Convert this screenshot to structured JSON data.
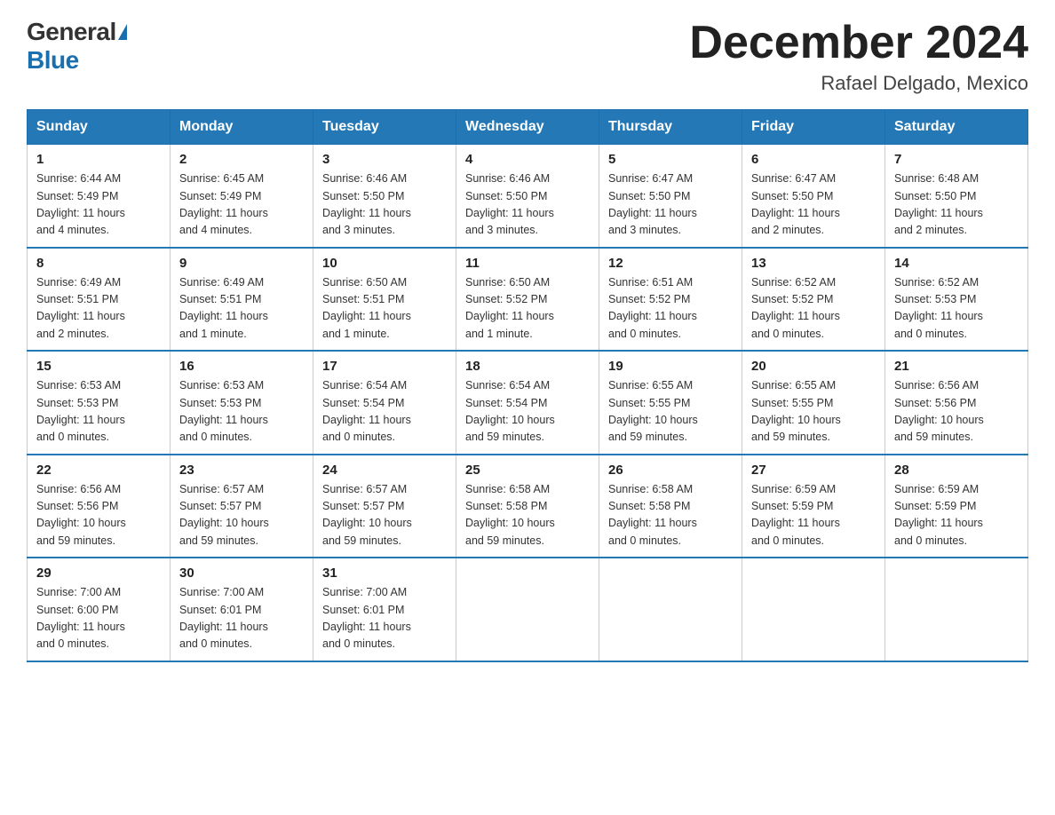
{
  "header": {
    "logo_general": "General",
    "logo_blue": "Blue",
    "month_title": "December 2024",
    "location": "Rafael Delgado, Mexico"
  },
  "days_of_week": [
    "Sunday",
    "Monday",
    "Tuesday",
    "Wednesday",
    "Thursday",
    "Friday",
    "Saturday"
  ],
  "weeks": [
    [
      {
        "day": "1",
        "sunrise": "6:44 AM",
        "sunset": "5:49 PM",
        "daylight": "11 hours and 4 minutes."
      },
      {
        "day": "2",
        "sunrise": "6:45 AM",
        "sunset": "5:49 PM",
        "daylight": "11 hours and 4 minutes."
      },
      {
        "day": "3",
        "sunrise": "6:46 AM",
        "sunset": "5:50 PM",
        "daylight": "11 hours and 3 minutes."
      },
      {
        "day": "4",
        "sunrise": "6:46 AM",
        "sunset": "5:50 PM",
        "daylight": "11 hours and 3 minutes."
      },
      {
        "day": "5",
        "sunrise": "6:47 AM",
        "sunset": "5:50 PM",
        "daylight": "11 hours and 3 minutes."
      },
      {
        "day": "6",
        "sunrise": "6:47 AM",
        "sunset": "5:50 PM",
        "daylight": "11 hours and 2 minutes."
      },
      {
        "day": "7",
        "sunrise": "6:48 AM",
        "sunset": "5:50 PM",
        "daylight": "11 hours and 2 minutes."
      }
    ],
    [
      {
        "day": "8",
        "sunrise": "6:49 AM",
        "sunset": "5:51 PM",
        "daylight": "11 hours and 2 minutes."
      },
      {
        "day": "9",
        "sunrise": "6:49 AM",
        "sunset": "5:51 PM",
        "daylight": "11 hours and 1 minute."
      },
      {
        "day": "10",
        "sunrise": "6:50 AM",
        "sunset": "5:51 PM",
        "daylight": "11 hours and 1 minute."
      },
      {
        "day": "11",
        "sunrise": "6:50 AM",
        "sunset": "5:52 PM",
        "daylight": "11 hours and 1 minute."
      },
      {
        "day": "12",
        "sunrise": "6:51 AM",
        "sunset": "5:52 PM",
        "daylight": "11 hours and 0 minutes."
      },
      {
        "day": "13",
        "sunrise": "6:52 AM",
        "sunset": "5:52 PM",
        "daylight": "11 hours and 0 minutes."
      },
      {
        "day": "14",
        "sunrise": "6:52 AM",
        "sunset": "5:53 PM",
        "daylight": "11 hours and 0 minutes."
      }
    ],
    [
      {
        "day": "15",
        "sunrise": "6:53 AM",
        "sunset": "5:53 PM",
        "daylight": "11 hours and 0 minutes."
      },
      {
        "day": "16",
        "sunrise": "6:53 AM",
        "sunset": "5:53 PM",
        "daylight": "11 hours and 0 minutes."
      },
      {
        "day": "17",
        "sunrise": "6:54 AM",
        "sunset": "5:54 PM",
        "daylight": "11 hours and 0 minutes."
      },
      {
        "day": "18",
        "sunrise": "6:54 AM",
        "sunset": "5:54 PM",
        "daylight": "10 hours and 59 minutes."
      },
      {
        "day": "19",
        "sunrise": "6:55 AM",
        "sunset": "5:55 PM",
        "daylight": "10 hours and 59 minutes."
      },
      {
        "day": "20",
        "sunrise": "6:55 AM",
        "sunset": "5:55 PM",
        "daylight": "10 hours and 59 minutes."
      },
      {
        "day": "21",
        "sunrise": "6:56 AM",
        "sunset": "5:56 PM",
        "daylight": "10 hours and 59 minutes."
      }
    ],
    [
      {
        "day": "22",
        "sunrise": "6:56 AM",
        "sunset": "5:56 PM",
        "daylight": "10 hours and 59 minutes."
      },
      {
        "day": "23",
        "sunrise": "6:57 AM",
        "sunset": "5:57 PM",
        "daylight": "10 hours and 59 minutes."
      },
      {
        "day": "24",
        "sunrise": "6:57 AM",
        "sunset": "5:57 PM",
        "daylight": "10 hours and 59 minutes."
      },
      {
        "day": "25",
        "sunrise": "6:58 AM",
        "sunset": "5:58 PM",
        "daylight": "10 hours and 59 minutes."
      },
      {
        "day": "26",
        "sunrise": "6:58 AM",
        "sunset": "5:58 PM",
        "daylight": "11 hours and 0 minutes."
      },
      {
        "day": "27",
        "sunrise": "6:59 AM",
        "sunset": "5:59 PM",
        "daylight": "11 hours and 0 minutes."
      },
      {
        "day": "28",
        "sunrise": "6:59 AM",
        "sunset": "5:59 PM",
        "daylight": "11 hours and 0 minutes."
      }
    ],
    [
      {
        "day": "29",
        "sunrise": "7:00 AM",
        "sunset": "6:00 PM",
        "daylight": "11 hours and 0 minutes."
      },
      {
        "day": "30",
        "sunrise": "7:00 AM",
        "sunset": "6:01 PM",
        "daylight": "11 hours and 0 minutes."
      },
      {
        "day": "31",
        "sunrise": "7:00 AM",
        "sunset": "6:01 PM",
        "daylight": "11 hours and 0 minutes."
      },
      null,
      null,
      null,
      null
    ]
  ],
  "labels": {
    "sunrise": "Sunrise:",
    "sunset": "Sunset:",
    "daylight": "Daylight:"
  }
}
